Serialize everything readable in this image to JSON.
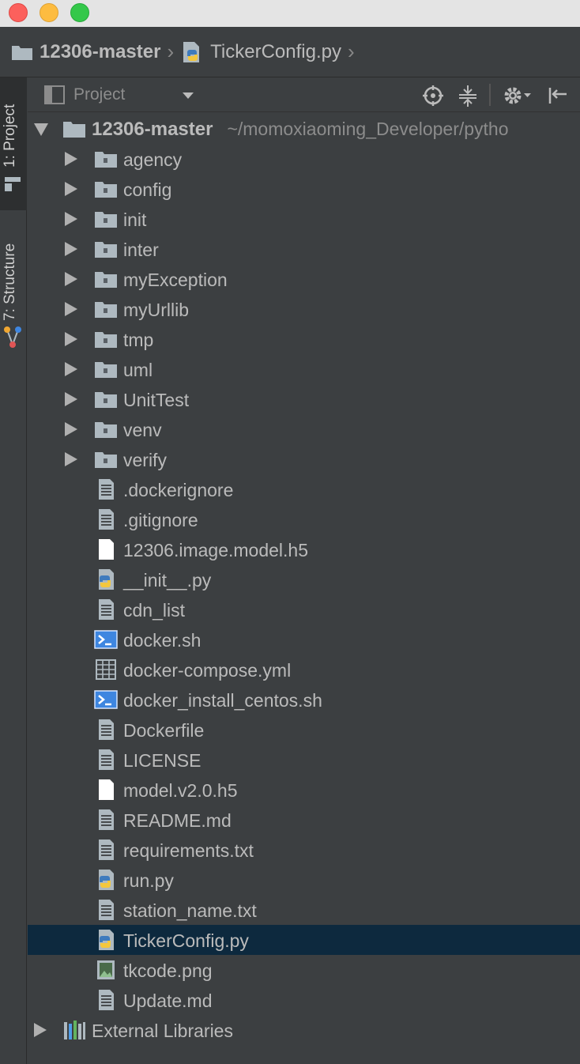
{
  "window": {
    "breadcrumb": [
      {
        "label": "12306-master",
        "icon": "folder-icon"
      },
      {
        "label": "TickerConfig.py",
        "icon": "python-file-icon"
      }
    ]
  },
  "toolstrip": {
    "project_label": "1: Project",
    "structure_label": "7: Structure"
  },
  "panel": {
    "view_label": "Project",
    "root": {
      "name": "12306-master",
      "path": "~/momoxiaoming_Developer/pytho"
    },
    "folders": [
      "agency",
      "config",
      "init",
      "inter",
      "myException",
      "myUrllib",
      "tmp",
      "uml",
      "UnitTest",
      "venv",
      "verify"
    ],
    "files": [
      {
        "name": ".dockerignore",
        "icon": "text-file-icon"
      },
      {
        "name": ".gitignore",
        "icon": "text-file-icon"
      },
      {
        "name": "12306.image.model.h5",
        "icon": "blank-file-icon"
      },
      {
        "name": "__init__.py",
        "icon": "python-file-icon"
      },
      {
        "name": "cdn_list",
        "icon": "text-file-icon"
      },
      {
        "name": "docker.sh",
        "icon": "shell-script-icon"
      },
      {
        "name": "docker-compose.yml",
        "icon": "yaml-file-icon"
      },
      {
        "name": "docker_install_centos.sh",
        "icon": "shell-script-icon"
      },
      {
        "name": "Dockerfile",
        "icon": "text-file-icon"
      },
      {
        "name": "LICENSE",
        "icon": "text-file-icon"
      },
      {
        "name": "model.v2.0.h5",
        "icon": "blank-file-icon"
      },
      {
        "name": "README.md",
        "icon": "text-file-icon"
      },
      {
        "name": "requirements.txt",
        "icon": "text-file-icon"
      },
      {
        "name": "run.py",
        "icon": "python-file-icon"
      },
      {
        "name": "station_name.txt",
        "icon": "text-file-icon"
      },
      {
        "name": "TickerConfig.py",
        "icon": "python-file-icon",
        "selected": true
      },
      {
        "name": "tkcode.png",
        "icon": "image-file-icon"
      },
      {
        "name": "Update.md",
        "icon": "text-file-icon"
      }
    ],
    "external_libraries": "External Libraries"
  },
  "colors": {
    "selection": "#0d293e",
    "panel_bg": "#3c3f41",
    "text": "#bbbbbb",
    "folder": "#aeb9c0",
    "shell": "#3e86e0",
    "python_blue": "#3f7bbd",
    "python_yellow": "#f3c73f"
  }
}
